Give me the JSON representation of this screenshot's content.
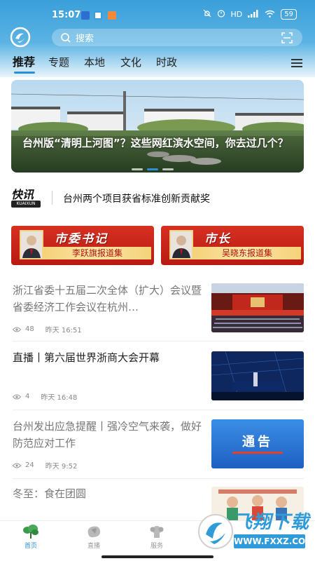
{
  "status_bar": {
    "time": "15:07",
    "battery": "59",
    "network": "HD"
  },
  "search": {
    "placeholder": "搜索"
  },
  "tabs": [
    {
      "label": "推荐",
      "active": true
    },
    {
      "label": "专题"
    },
    {
      "label": "本地"
    },
    {
      "label": "文化"
    },
    {
      "label": "时政"
    }
  ],
  "banner": {
    "title": "台州版“清明上河图”？这些网红滨水空间，你去过几个？",
    "slide_count": 3,
    "active_slide": 2
  },
  "kuaixun": {
    "logo": "快讯",
    "logo_sub": "KUAIXUN",
    "headline": "台州两个项目获省标准创新贡献奖"
  },
  "leaders": [
    {
      "title": "市委书记",
      "subtitle": "李跃旗报道集"
    },
    {
      "title": "市长",
      "subtitle": "吴晓东报道集"
    }
  ],
  "news": [
    {
      "title": "浙江省委十五届二次全体（扩大）会议暨省委经济工作会议在杭州…",
      "views": "48",
      "time": "昨天 16:51",
      "read": true
    },
    {
      "title": "直播丨第六届世界浙商大会开幕",
      "views": "4",
      "time": "昨天 16:48",
      "read": false
    },
    {
      "title": "台州发出应急提醒丨强冷空气来袭，做好防范应对工作",
      "views": "24",
      "time": "昨天 9:52",
      "read": true,
      "thumb_text": "通告"
    },
    {
      "title": "冬至：食在团圆",
      "read": true
    }
  ],
  "bottom_nav": [
    {
      "label": "首页",
      "active": true
    },
    {
      "label": "直播"
    },
    {
      "label": "服务"
    }
  ],
  "watermark": {
    "text": "飞翔下载",
    "url": "WWW.FXXZ.COM"
  },
  "colors": {
    "primary": "#2b8fd8",
    "header": "#3a9fd9",
    "leader_red": "#c8241a",
    "gold": "#f5d27a"
  }
}
